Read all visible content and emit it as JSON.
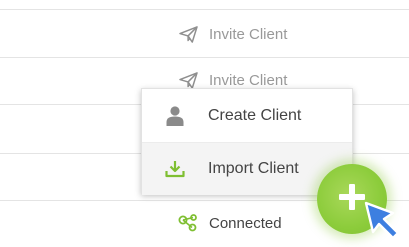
{
  "rows": [
    {
      "action_label": "Invite Client",
      "action_icon": "paper-plane-icon"
    },
    {
      "action_label": "Invite Client",
      "action_icon": "paper-plane-icon"
    },
    {
      "status_label": "Connected",
      "status_icon": "share-nodes-icon"
    }
  ],
  "menu": {
    "items": [
      {
        "label": "Create Client",
        "icon": "user-icon"
      },
      {
        "label": "Import Client",
        "icon": "download-icon"
      }
    ]
  },
  "fab": {
    "icon": "plus-icon"
  },
  "colors": {
    "accent_green": "#8ccc3b",
    "muted_text": "#999999",
    "body_text": "#444444",
    "cursor_blue": "#3d7fe0"
  }
}
